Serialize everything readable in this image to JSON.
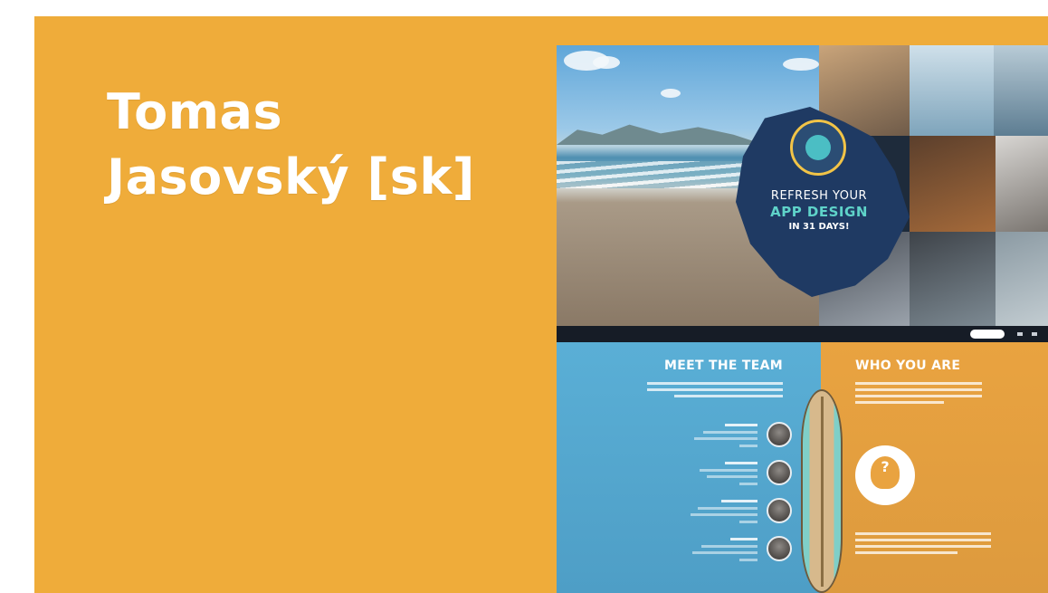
{
  "card": {
    "title_line1": "Tomas",
    "title_line2": "Jasovský [sk]",
    "background": "#efac3a"
  },
  "preview": {
    "hero": {
      "line1": "REFRESH YOUR",
      "line2": "APP DESIGN",
      "line3": "IN 31 DAYS!"
    },
    "sections": {
      "team_heading": "MEET THE TEAM",
      "who_heading": "WHO YOU ARE"
    },
    "colors": {
      "team_blue": "#5aafd6",
      "who_orange": "#e9a340",
      "hero_navy": "#1f3a63",
      "accent_teal": "#5fd3c9"
    },
    "icons": [
      "badge-logo-icon",
      "unknown-person-icon",
      "surfboard-illustration"
    ]
  }
}
